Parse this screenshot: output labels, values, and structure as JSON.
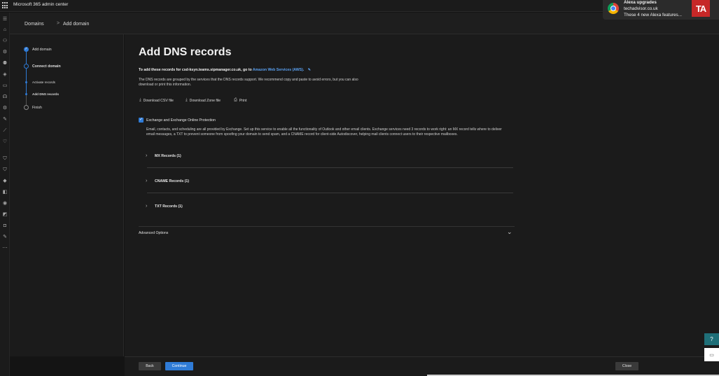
{
  "app": {
    "title": "Microsoft 365 admin center"
  },
  "breadcrumb": {
    "items": [
      "Domains",
      "Add domain"
    ],
    "separator": ">"
  },
  "stepper": {
    "steps": [
      {
        "label": "Add domain",
        "state": "complete"
      },
      {
        "label": "Connect domain",
        "state": "current"
      },
      {
        "label": "Activate records",
        "state": "substep"
      },
      {
        "label": "Add DNS records",
        "state": "substep-current"
      },
      {
        "label": "Finish",
        "state": "pending"
      }
    ]
  },
  "main": {
    "title": "Add DNS records",
    "intro_prefix": "To add these records for csd-ksyn.teams.sipmanager.co.uk, go to ",
    "intro_link": "Amazon Web Services (AWS).",
    "description": "The DNS records are grouped by the services that the DNS records support. We recommend copy and paste to avoid errors, but you can also download or print this information.",
    "actions": [
      {
        "label": "Download CSV file",
        "icon": "download-icon"
      },
      {
        "label": "Download Zone file",
        "icon": "download-icon"
      },
      {
        "label": "Print",
        "icon": "print-icon"
      }
    ],
    "service": {
      "label": "Exchange and Exchange Online Protection",
      "checked": true,
      "description": "Email, contacts, and scheduling are all provided by Exchange. Set up this service to enable all the functionality of Outlook and other email clients. Exchange services need 3 records to work right: an MX record tells where to deliver email messages, a TXT to prevent someone from spoofing your domain to send spam, and a CNAME record for client-side Autodiscover, helping mail clients connect users to their respective mailboxes."
    },
    "record_groups": [
      {
        "label": "MX Records (1)"
      },
      {
        "label": "CNAME Records (1)"
      },
      {
        "label": "TXT Records (1)"
      }
    ],
    "advanced": {
      "label": "Advanced Options"
    }
  },
  "footer": {
    "back": "Back",
    "continue": "Continue",
    "close": "Close"
  },
  "notification": {
    "title": "Alexa upgrades",
    "source": "techadvisor.co.uk",
    "body": "These 4 new Alexa features...",
    "logo_text": "TA"
  },
  "colors": {
    "accent": "#2f7bd6",
    "link": "#5aa0f0",
    "ta_red": "#c62828"
  }
}
